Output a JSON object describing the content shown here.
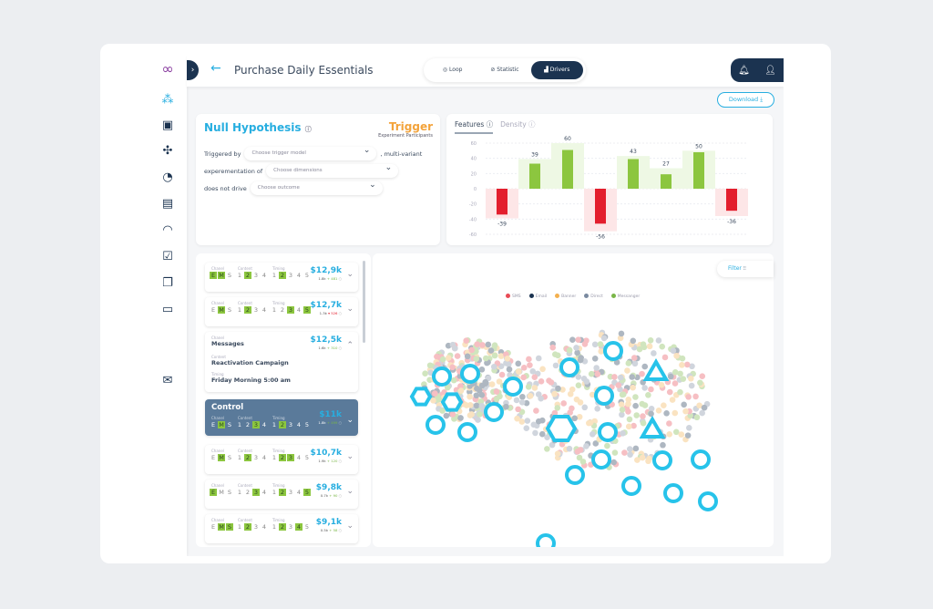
{
  "header": {
    "title": "Purchase Daily Essentials",
    "tabs": [
      {
        "label": "Loop",
        "icon": "loop-icon"
      },
      {
        "label": "Statistic",
        "icon": "statistic-icon"
      },
      {
        "label": "Drivers",
        "icon": "drivers-icon",
        "active": true
      }
    ],
    "download_label": "Download"
  },
  "sidebar": {
    "icons": [
      "logo-infinity",
      "drivers-icon",
      "dashboard-icon",
      "network-icon",
      "pie-chart-icon",
      "clipboard-icon",
      "gauge-icon",
      "checklist-icon",
      "documents-icon",
      "book-icon",
      "feedback-icon"
    ]
  },
  "hypothesis": {
    "title": "Null Hypothesis",
    "trigger": "Trigger",
    "trigger_sub": "Experiment Participants",
    "row1_label": "Triggered by",
    "row1_placeholder": "Choose trigger model",
    "row1_suffix": ", multi-variant",
    "row2_label": "experementation of",
    "row2_placeholder": "Choose dimensions",
    "row3_label": "does not drive",
    "row3_placeholder": "Choose outcome"
  },
  "chart_tabs": [
    "Features",
    "Density"
  ],
  "chart_data": {
    "type": "bar",
    "values": [
      -39,
      39,
      60,
      -56,
      43,
      27,
      50,
      -36
    ],
    "bar_values": [
      -34,
      33,
      51,
      -46,
      39,
      19,
      48,
      -29
    ],
    "ylim": [
      -60,
      60
    ],
    "yticks": [
      60,
      40,
      20,
      0,
      -20,
      -40,
      -60
    ],
    "grid": true,
    "colors": {
      "positive": "#8cc63f",
      "negative": "#e31e2d",
      "positive_bg": "#eef8e4",
      "negative_bg": "#fde6e7"
    }
  },
  "labels": {
    "channel": "Chanel",
    "content": "Content",
    "timing": "Timing"
  },
  "items": [
    {
      "price": "$12,9k",
      "base": "1.8k",
      "delta": "+ 481",
      "up": true,
      "ch": [
        "E",
        "M"
      ],
      "co": [
        2
      ],
      "ti": [
        2
      ]
    },
    {
      "price": "$12,7k",
      "base": "1.3k",
      "delta": "▾ 526",
      "up": false,
      "ch": [
        "M"
      ],
      "co": [
        2
      ],
      "ti": [
        3,
        5
      ]
    },
    {
      "expanded": true,
      "price": "$12,5k",
      "base": "1.6k",
      "delta": "+ 310",
      "up": true,
      "channel": "Messages",
      "content": "Reactivation Campaign",
      "timing": "Friday Morning 5:00 am"
    },
    {
      "control": true,
      "title": "Control",
      "price": "$11k",
      "base": "1.8k",
      "delta": "+ 499",
      "up": true,
      "ch": [
        "M"
      ],
      "co": [
        3
      ],
      "ti": [
        2
      ]
    },
    {
      "price": "$10,7k",
      "base": "1.9k",
      "delta": "+ 120",
      "up": true,
      "ch": [
        "M"
      ],
      "co": [
        2
      ],
      "ti": [
        2,
        3
      ]
    },
    {
      "price": "$9,8k",
      "base": "0.7k",
      "delta": "+ 90",
      "up": true,
      "ch": [
        "E"
      ],
      "co": [
        3
      ],
      "ti": [
        2,
        5
      ]
    },
    {
      "price": "$9,1k",
      "base": "0.5k",
      "delta": "+ 58",
      "up": true,
      "ch": [
        "M",
        "S"
      ],
      "co": [
        2
      ],
      "ti": [
        2,
        4
      ]
    }
  ],
  "scatter": {
    "filter_label": "Filter",
    "legend": [
      {
        "name": "SMS",
        "color": "#e84b55"
      },
      {
        "name": "Email",
        "color": "#1b3350"
      },
      {
        "name": "Banner",
        "color": "#f3b04f"
      },
      {
        "name": "Direct",
        "color": "#7a8aa0"
      },
      {
        "name": "Messanger",
        "color": "#7ab648"
      }
    ],
    "highlight_color": "#27c3ea"
  }
}
